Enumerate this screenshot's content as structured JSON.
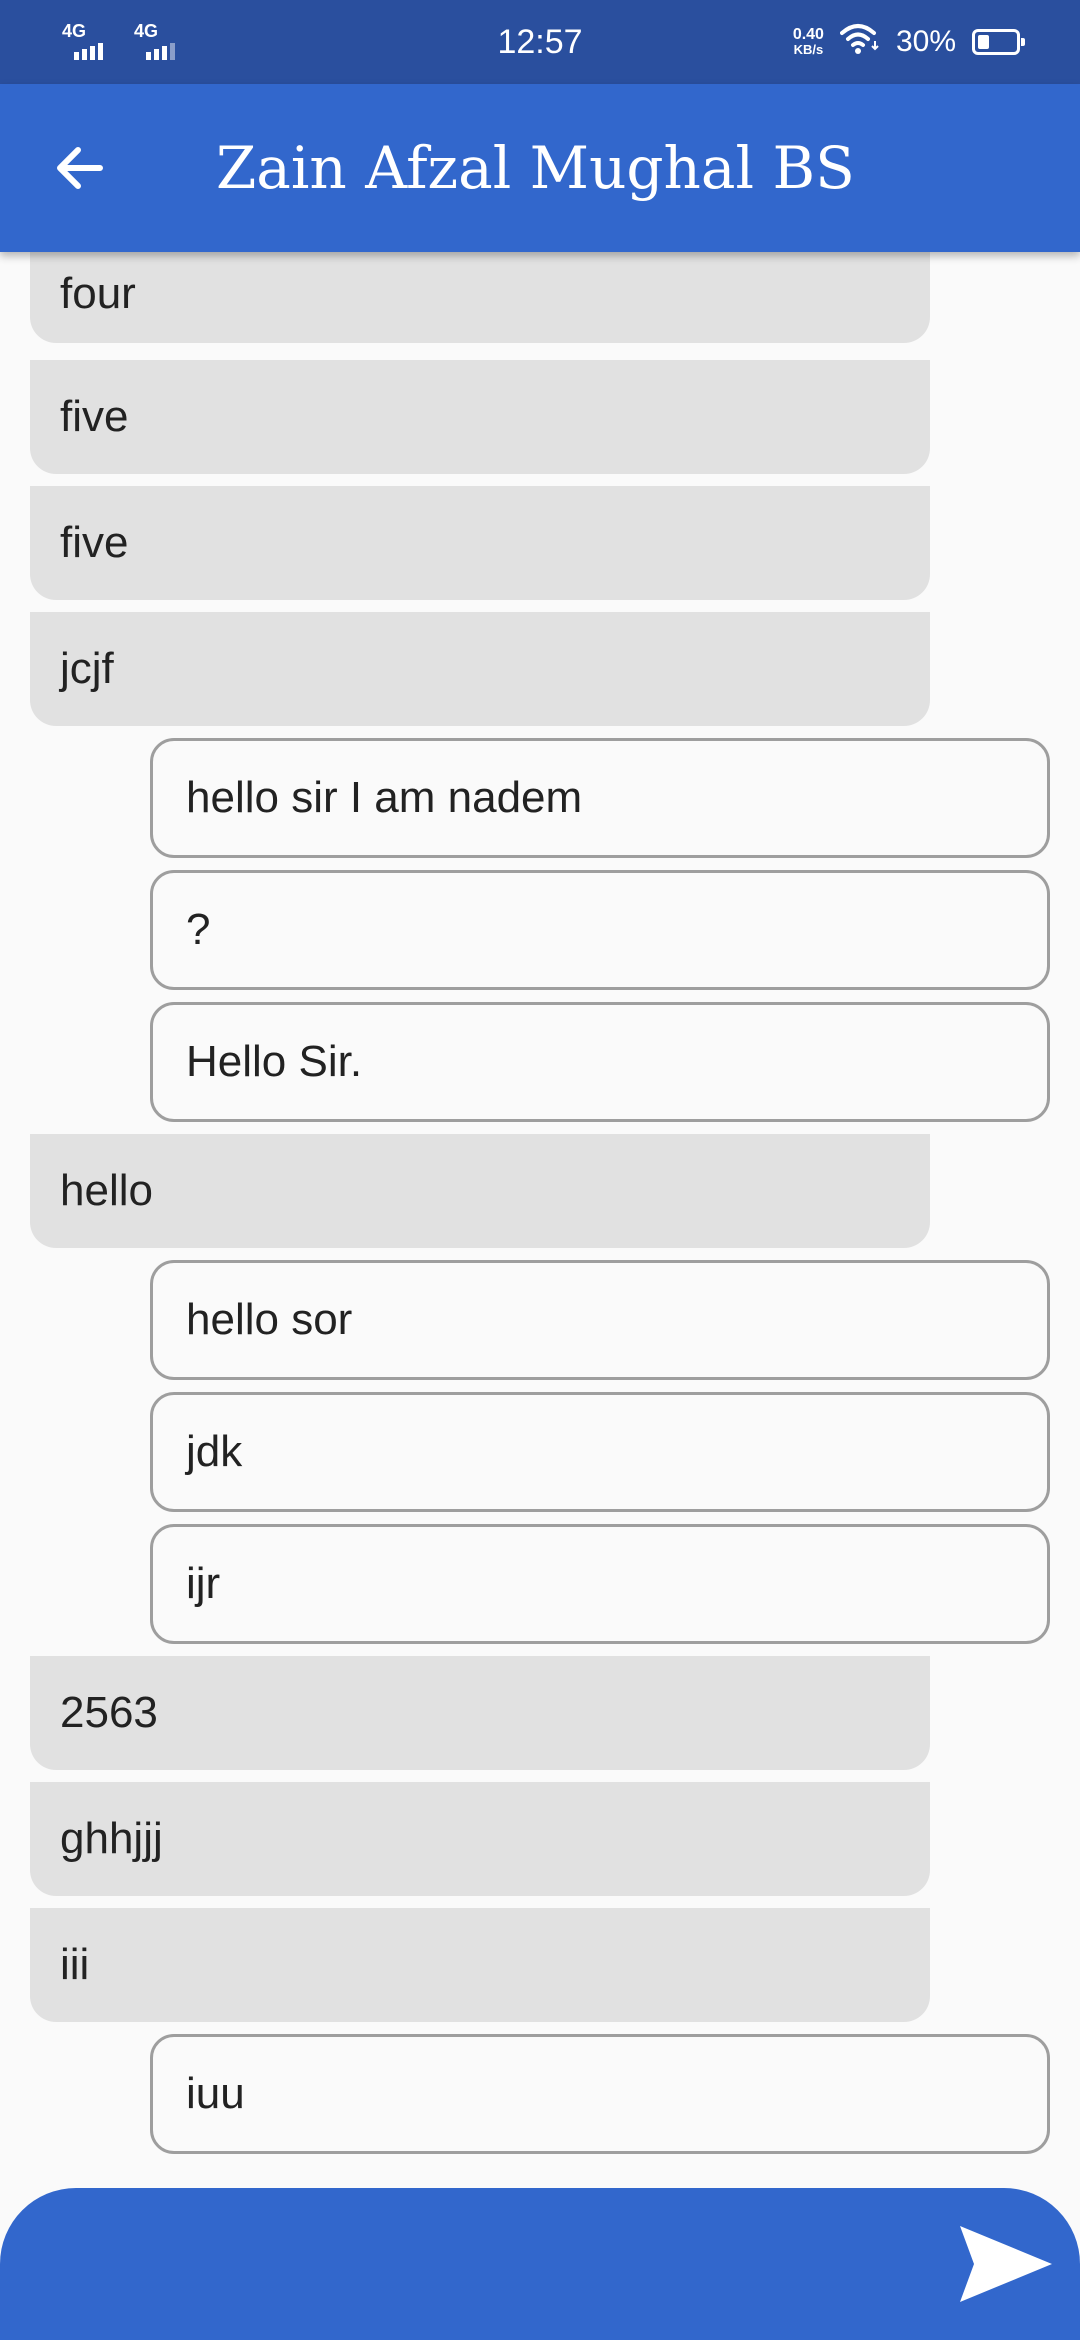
{
  "status_bar": {
    "network_1": "4G",
    "network_2": "4G",
    "time": "12:57",
    "speed_value": "0.40",
    "speed_unit": "KB/s",
    "battery_percent": "30%",
    "battery_level": 0.3
  },
  "app_bar": {
    "back_icon": "arrow-left-icon",
    "title": "Zain Afzal Mughal BS"
  },
  "messages": [
    {
      "text": "four",
      "type": "received"
    },
    {
      "text": "five",
      "type": "received"
    },
    {
      "text": "five",
      "type": "received"
    },
    {
      "text": "jcjf",
      "type": "received"
    },
    {
      "text": "hello sir I am nadem",
      "type": "sent"
    },
    {
      "text": "?",
      "type": "sent"
    },
    {
      "text": "Hello Sir.",
      "type": "sent"
    },
    {
      "text": "hello",
      "type": "received"
    },
    {
      "text": "hello sor",
      "type": "sent"
    },
    {
      "text": "jdk",
      "type": "sent"
    },
    {
      "text": "ijr",
      "type": "sent"
    },
    {
      "text": "2563",
      "type": "received"
    },
    {
      "text": "ghhjjj",
      "type": "received"
    },
    {
      "text": "iii",
      "type": "received"
    },
    {
      "text": "iuu",
      "type": "sent"
    }
  ],
  "composer": {
    "placeholder": "",
    "send_icon": "send-icon"
  },
  "colors": {
    "primary": "#3267cc",
    "status_bar": "#2a4f9e",
    "received_bubble": "#e1e1e1",
    "sent_border": "#9e9e9e",
    "background": "#fafafa"
  }
}
